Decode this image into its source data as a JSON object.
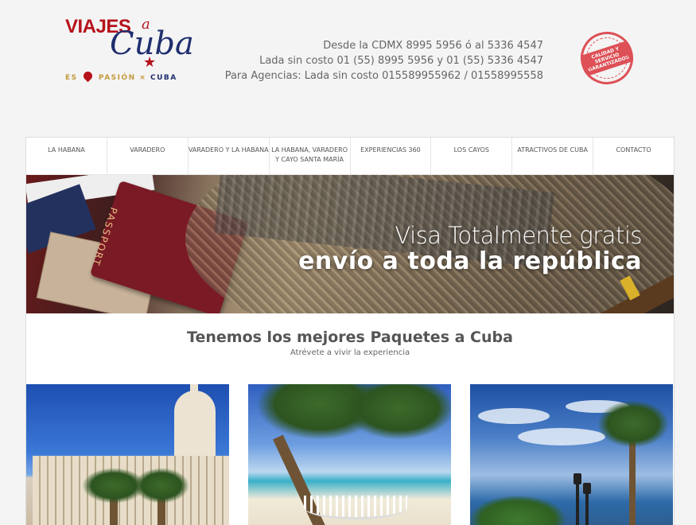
{
  "logo": {
    "viajes": "VIAJES",
    "a": "a",
    "cuba": "Cuba",
    "tagline_left": "ES",
    "tagline_mid": "PASIÓN × ",
    "tagline_right": "CUBA"
  },
  "contact": {
    "line1": "Desde la CDMX 8995 5956 ó al 5336 4547",
    "line2": "Lada sin costo 01 (55) 8995 5956 y 01 (55) 5336 4547",
    "line3": "Para Agencias: Lada sin costo 015589955962 / 01558995558"
  },
  "seal": {
    "text": "CALIDAD Y SERVICIO GARANTIZADOS"
  },
  "nav": {
    "items": [
      "LA HABANA",
      "VARADERO",
      "VARADERO Y LA HABANA",
      "LA HABANA, VARADERO Y CAYO SANTA MARÍA",
      "EXPERIENCIAS 360",
      "LOS CAYOS",
      "ATRACTIVOS DE CUBA",
      "CONTACTO"
    ]
  },
  "banner": {
    "line1": "Visa Totalmente gratis",
    "line2": "envío a toda la república",
    "passport_text": "PASSPORT"
  },
  "section": {
    "title": "Tenemos los mejores Paquetes a Cuba",
    "subtitle": "Atrévete a vivir la experiencia"
  },
  "colors": {
    "brand_red": "#b5121b",
    "brand_blue": "#1f2e6e",
    "accent_gold": "#c49a3d"
  }
}
